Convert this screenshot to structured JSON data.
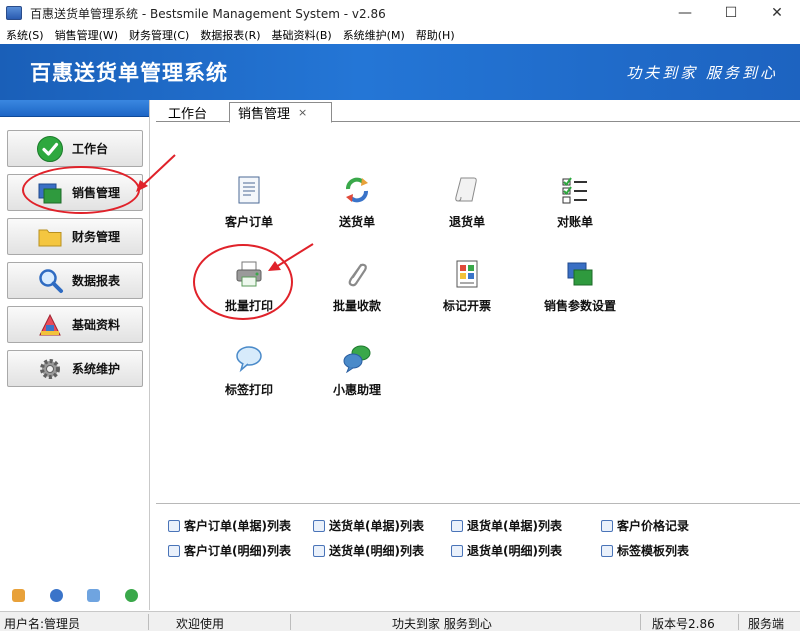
{
  "window": {
    "title": "百惠送货单管理系统 - Bestsmile Management System - v2.86",
    "controls": [
      "—",
      "☐",
      "✕"
    ]
  },
  "menu": [
    "系统(S)",
    "销售管理(W)",
    "财务管理(C)",
    "数据报表(R)",
    "基础资料(B)",
    "系统维护(M)",
    "帮助(H)"
  ],
  "banner": {
    "title": "百惠送货单管理系统",
    "slogan": "功夫到家 服务到心"
  },
  "sidebar": {
    "items": [
      {
        "label": "工作台",
        "icon": "check-icon",
        "color": "#2aa03a"
      },
      {
        "label": "销售管理",
        "icon": "windows-icon",
        "color": "#2f8a3c"
      },
      {
        "label": "财务管理",
        "icon": "folder-icon",
        "color": "#f2c23a"
      },
      {
        "label": "数据报表",
        "icon": "magnifier-icon",
        "color": "#3a74c9"
      },
      {
        "label": "基础资料",
        "icon": "building-icon",
        "color": "#c8364a"
      },
      {
        "label": "系统维护",
        "icon": "gear-icon",
        "color": "#8a8a8a"
      }
    ],
    "footer_icons": [
      "key-icon",
      "clock-icon",
      "search-icon",
      "back-icon"
    ]
  },
  "tabs": {
    "items": [
      {
        "label": "工作台"
      },
      {
        "label": "销售管理",
        "close": "×"
      }
    ],
    "active": "销售管理"
  },
  "grid": {
    "items": [
      {
        "label": "客户订单",
        "icon": "form-icon"
      },
      {
        "label": "送货单",
        "icon": "refresh-arrows-icon"
      },
      {
        "label": "退货单",
        "icon": "scroll-icon"
      },
      {
        "label": "对账单",
        "icon": "checklist-icon"
      },
      {
        "label": "批量打印",
        "icon": "printer-icon"
      },
      {
        "label": "批量收款",
        "icon": "paperclip-icon"
      },
      {
        "label": "记开票",
        "icon": "invoice-icon",
        "full": "标记开票"
      },
      {
        "label": "销售参数设置",
        "icon": "settings-window-icon"
      },
      {
        "label": "标签打印",
        "icon": "speech-bubble-icon"
      },
      {
        "label": "小惠助理",
        "icon": "chat-bubbles-icon"
      }
    ]
  },
  "links": [
    "客户订单(单据)列表",
    "送货单(单据)列表",
    "退货单(单据)列表",
    "客户价格记录",
    "客户订单(明细)列表",
    "送货单(明细)列表",
    "退货单(明细)列表",
    "标签模板列表"
  ],
  "status": {
    "user": "用户名:管理员",
    "welcome": "欢迎使用",
    "slogan": "功夫到家 服务到心",
    "version": "版本号2.86",
    "mode": "服务端"
  }
}
